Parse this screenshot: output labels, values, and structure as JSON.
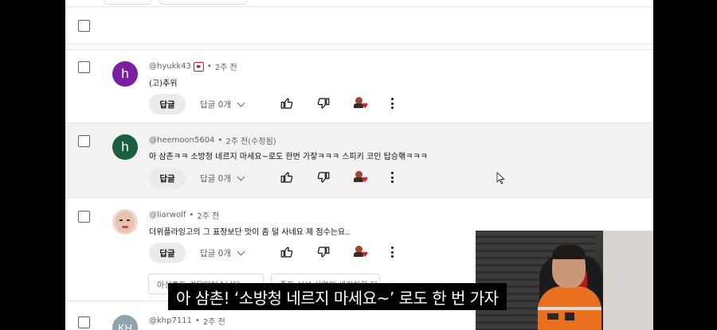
{
  "comments": [
    {
      "author": "@hyukk43",
      "time": "2주 전",
      "text": "(고)추위",
      "avatar_letter": "h",
      "avatar_color": "#7b1fa2",
      "reply_label": "답글",
      "replies_label": "답글 0개",
      "has_badge": true
    },
    {
      "author": "@heemoon5604",
      "time": "2주 전(수정됨)",
      "text": "아 삼촌ㅋㅋ 소방청 네르지 마세요~로도 한번 가잫ㅋㅋㅋ 스피키 코인 탑승핶ㅋㅋㅋ",
      "avatar_letter": "h",
      "avatar_color": "#1b5e3f",
      "reply_label": "답글",
      "replies_label": "답글 0개"
    },
    {
      "author": "@liarwolf",
      "time": "2주 전",
      "text": "더위플라잉고의 그 표정보단 맛이 좀 덜 사네요 제 점수는요..",
      "avatar_letter": "",
      "avatar_color": "#f0d8d0",
      "reply_label": "답글",
      "replies_label": "답글 0개"
    },
    {
      "author": "@khp7111",
      "time": "2주 전",
      "avatar_letter": "KH",
      "avatar_color": "#90a4ae"
    }
  ],
  "chips": [
    "아싱혹도 걸음있어손났다",
    "졸도 신선 서연의 생각하한 당"
  ],
  "subtitle": "아 삼촌! ‘소방청 네르지 마세요~’ 로도 한 번 가자",
  "colors": {
    "like": "#0f0f0f",
    "heart": "#e01b2b"
  }
}
